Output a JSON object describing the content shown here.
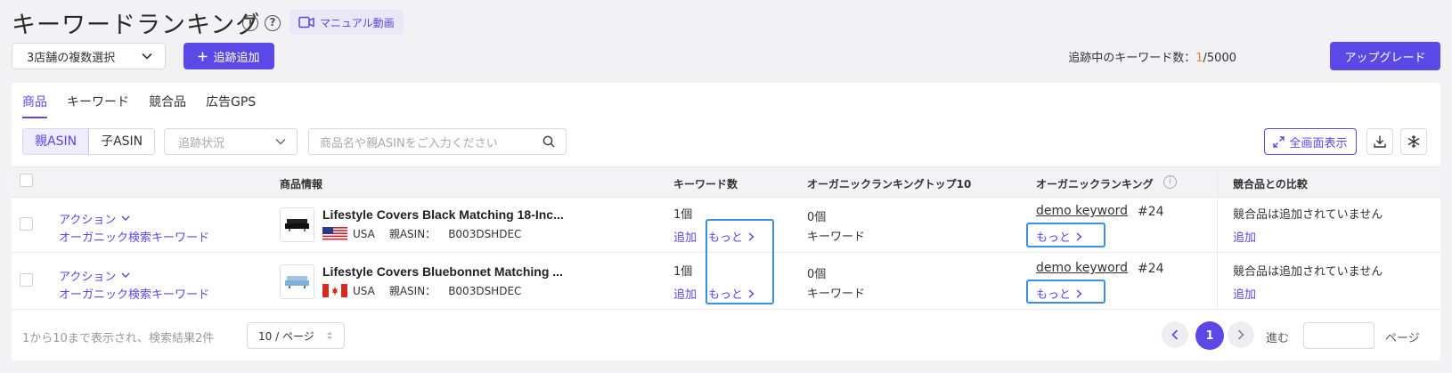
{
  "header": {
    "title": "キーワードランキング",
    "info_icon": "info-icon",
    "help_icon": "help-icon",
    "manual_label": "マニュアル動画",
    "store_select_value": "3店舗の複数選択",
    "add_track_label": "追跡追加",
    "track_count_label": "追跡中のキーワード数：",
    "track_count_current": "1",
    "track_count_total": "/5000",
    "upgrade_label": "アップグレード"
  },
  "tabs": [
    {
      "label": "商品",
      "active": true
    },
    {
      "label": "キーワード",
      "active": false
    },
    {
      "label": "競合品",
      "active": false
    },
    {
      "label": "広告GPS",
      "active": false
    }
  ],
  "toolbar": {
    "parent_asin": "親ASIN",
    "child_asin": "子ASIN",
    "track_status_placeholder": "追跡状況",
    "search_placeholder": "商品名や親ASINをご入力ください",
    "fullscreen_label": "全画面表示"
  },
  "table": {
    "headers": {
      "product_info": "商品情報",
      "keyword_count": "キーワード数",
      "organic_top10": "オーガニックランキングトップ10",
      "organic_ranking": "オーガニックランキング",
      "competitor_compare": "競合品との比較"
    },
    "rows": [
      {
        "action": "アクション",
        "organic_search": "オーガニック検索キーワード",
        "product_name": "Lifestyle Covers Black Matching 18-Inc...",
        "country": "USA",
        "asin_label": "親ASIN：",
        "asin": "B003DSHDEC",
        "keyword_count": "1個",
        "add": "追加",
        "more": "もっと",
        "top10_count": "0個",
        "top10_label": "キーワード",
        "keyword": "demo keyword",
        "rank": "#24",
        "competitor_text": "競合品は追加されていません",
        "competitor_add": "追加"
      },
      {
        "action": "アクション",
        "organic_search": "オーガニック検索キーワード",
        "product_name": "Lifestyle Covers Bluebonnet Matching ...",
        "country": "USA",
        "asin_label": "親ASIN：",
        "asin": "B003DSHDEC",
        "keyword_count": "1個",
        "add": "追加",
        "more": "もっと",
        "top10_count": "0個",
        "top10_label": "キーワード",
        "keyword": "demo keyword",
        "rank": "#24",
        "competitor_text": "競合品は追加されていません",
        "competitor_add": "追加"
      }
    ]
  },
  "footer": {
    "summary": "1から10まで表示され、検索結果2件",
    "page_size": "10 / ページ",
    "current_page": "1",
    "goto_label": "進む",
    "page_label": "ページ"
  },
  "colors": {
    "accent": "#5b48e6",
    "highlight": "#3a8ee6",
    "count": "#f07b2f"
  }
}
